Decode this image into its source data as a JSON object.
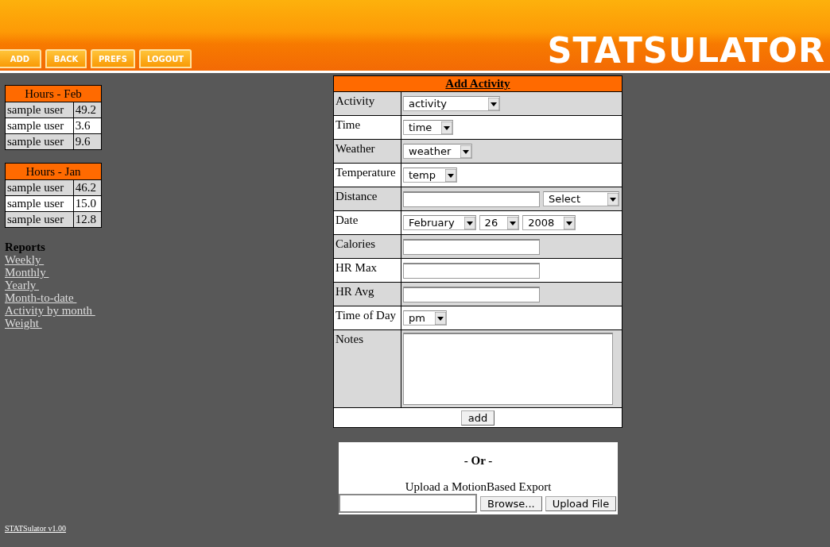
{
  "header": {
    "logo": {
      "bold": "STATS",
      "light": "ULATOR"
    },
    "nav": [
      "ADD",
      "BACK",
      "PREFS",
      "LOGOUT"
    ]
  },
  "sidebar": {
    "tables": [
      {
        "title": "Hours - Feb",
        "rows": [
          {
            "name": "sample user",
            "hours": "49.2"
          },
          {
            "name": "sample user",
            "hours": "3.6"
          },
          {
            "name": "sample user",
            "hours": "9.6"
          }
        ]
      },
      {
        "title": "Hours - Jan",
        "rows": [
          {
            "name": "sample user",
            "hours": "46.2"
          },
          {
            "name": "sample user",
            "hours": "15.0"
          },
          {
            "name": "sample user",
            "hours": "12.8"
          }
        ]
      }
    ],
    "reports": {
      "title": "Reports",
      "links": [
        "Weekly",
        "Monthly",
        "Yearly",
        "Month-to-date",
        "Activity by month",
        "Weight"
      ]
    }
  },
  "form": {
    "title": "Add Activity",
    "rows": [
      {
        "label": "Activity",
        "kind": "select",
        "selects": [
          {
            "value": "activity"
          }
        ]
      },
      {
        "label": "Time",
        "kind": "select",
        "selects": [
          {
            "value": "time"
          }
        ]
      },
      {
        "label": "Weather",
        "kind": "select",
        "selects": [
          {
            "value": "weather"
          }
        ]
      },
      {
        "label": "Temperature",
        "kind": "select",
        "selects": [
          {
            "value": "temp"
          }
        ]
      },
      {
        "label": "Distance",
        "kind": "text_select",
        "selects": [
          {
            "value": "Select"
          }
        ]
      },
      {
        "label": "Date",
        "kind": "select",
        "selects": [
          {
            "value": "February"
          },
          {
            "value": "26"
          },
          {
            "value": "2008"
          }
        ]
      },
      {
        "label": "Calories",
        "kind": "text"
      },
      {
        "label": "HR Max",
        "kind": "text"
      },
      {
        "label": "HR Avg",
        "kind": "text"
      },
      {
        "label": "Time of Day",
        "kind": "select",
        "selects": [
          {
            "value": "pm"
          }
        ]
      },
      {
        "label": "Notes",
        "kind": "textarea"
      }
    ],
    "submit": "add"
  },
  "upload": {
    "divider": "- Or -",
    "label": "Upload a MotionBased Export",
    "browse": "Browse...",
    "button": "Upload File"
  },
  "footer": {
    "link": "STATSulator v1.00"
  }
}
